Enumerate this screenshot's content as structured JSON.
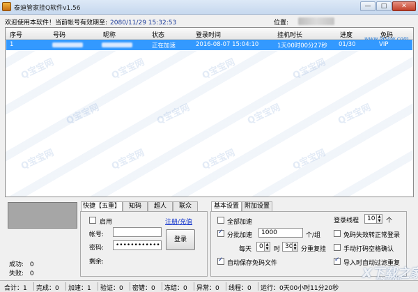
{
  "window": {
    "title": "泰迪管家挂Q软件v1.56",
    "minimize": "—",
    "maximize": "□",
    "close": "✕"
  },
  "info": {
    "welcome": "欢迎使用本软件！当前帐号有效期至:",
    "expiry": "2080/11/29 15:32:53",
    "location_label": "位置:"
  },
  "list": {
    "columns": [
      "序号",
      "号码",
      "昵称",
      "状态",
      "登录时间",
      "挂机时长",
      "进度",
      "免码"
    ],
    "rows": [
      {
        "index": "1",
        "status": "正在加速",
        "login_time": "2016-08-07 15:04:10",
        "duration": "1天00时00分27秒",
        "progress": "01/30",
        "vip": "VIP"
      }
    ],
    "watermark_site": "www.lasnw.com",
    "watermark_text": "Q宝宝网"
  },
  "stats": {
    "success_label": "成功:",
    "success": "0",
    "fail_label": "失败:",
    "fail": "0"
  },
  "login_panel": {
    "tabs": [
      "快捷【五重】",
      "知码",
      "超人",
      "联众"
    ],
    "enable_label": "启用",
    "register_link": "注册/充值",
    "account_label": "帐号:",
    "account_value": "",
    "password_label": "密码:",
    "password_value": "•••••••••••••",
    "remaining_label": "剩余:",
    "login_button": "登录"
  },
  "settings": {
    "tabs": [
      "基本设置",
      "附加设置"
    ],
    "full_speed": "全部加速",
    "batch_speed": "分批加速",
    "batch_value": "1000",
    "per_group": "个/组",
    "every_day": "每天",
    "hour_value": "0",
    "hour_unit": "时",
    "minute_value": "30",
    "repeat_login": "分重复挂",
    "auto_save": "自动保存免码文件",
    "login_threads_label": "登录线程",
    "login_threads_value": "10",
    "login_threads_unit": "个",
    "opt_1": "免码失效转正常登录",
    "opt_2": "手动打码空格确认",
    "opt_3": "导入时自动过滤重复"
  },
  "statusbar": {
    "items": [
      "合计：1",
      "完成：0",
      "加速：1",
      "验证：0",
      "密错：0",
      "冻结：0",
      "异常：0",
      "线程：0",
      "运行：0天00小时11分20秒"
    ]
  },
  "watermark_logo": "X下载之家",
  "watermark_logo_sub": "jz5u.com"
}
